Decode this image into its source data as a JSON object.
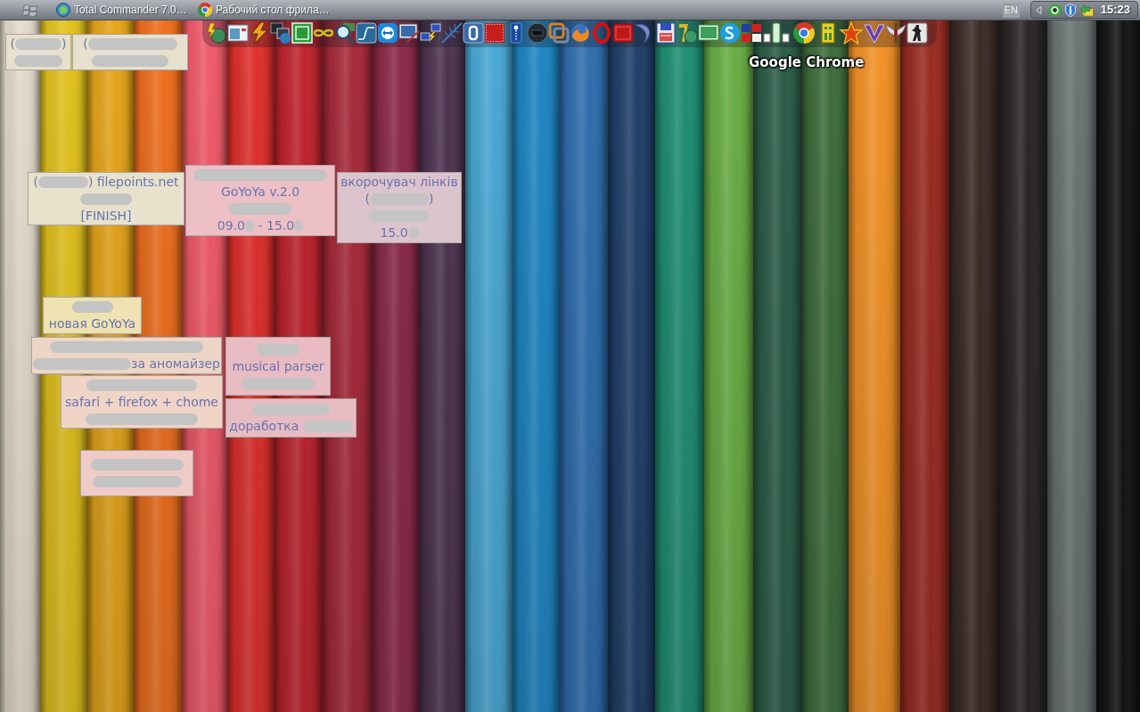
{
  "taskbar": {
    "tasks": [
      {
        "label": "Total Commander 7.0…"
      },
      {
        "label": "Рабочий стол фрила…"
      }
    ],
    "language": "EN",
    "clock": "15:23"
  },
  "dock": {
    "tooltip": "Google Chrome"
  },
  "notes": [
    {
      "color": "#e6e0cc",
      "lines": [
        [
          {
            "kind": "text",
            "text": "("
          },
          {
            "kind": "redacted"
          },
          {
            "kind": "text",
            "text": ")"
          }
        ],
        [
          {
            "kind": "redacted"
          }
        ]
      ]
    },
    {
      "color": "#e6e0cc",
      "lines": [
        [
          {
            "kind": "text",
            "text": "("
          },
          {
            "kind": "redacted"
          }
        ],
        [
          {
            "kind": "redacted"
          }
        ]
      ]
    },
    {
      "color": "#e8e2cc",
      "lines": [
        [
          {
            "kind": "text",
            "text": "("
          },
          {
            "kind": "redacted"
          },
          {
            "kind": "text",
            "text": ") filepoints.net"
          }
        ],
        [
          {
            "kind": "redacted"
          }
        ],
        [
          {
            "kind": "text",
            "text": "[FINISH]"
          }
        ]
      ]
    },
    {
      "color": "#edc0c6",
      "lines": [
        [
          {
            "kind": "redacted"
          }
        ],
        [
          {
            "kind": "text",
            "text": "GoYoYa v.2.0"
          }
        ],
        [
          {
            "kind": "redacted"
          }
        ],
        [
          {
            "kind": "text",
            "text": "09.0"
          },
          {
            "kind": "redacted"
          },
          {
            "kind": "text",
            "text": " - 15.0"
          },
          {
            "kind": "redacted"
          }
        ]
      ]
    },
    {
      "color": "#dcc4cc",
      "lines": [
        [
          {
            "kind": "text",
            "text": "вкорочувач лінків"
          }
        ],
        [
          {
            "kind": "text",
            "text": "("
          },
          {
            "kind": "redacted"
          },
          {
            "kind": "text",
            "text": ")"
          }
        ],
        [
          {
            "kind": "redacted"
          }
        ],
        [
          {
            "kind": "text",
            "text": "15.0"
          },
          {
            "kind": "redacted"
          }
        ]
      ]
    },
    {
      "color": "#eee2b0",
      "lines": [
        [
          {
            "kind": "redacted"
          }
        ],
        [
          {
            "kind": "text",
            "text": "новая GoYoYa"
          }
        ]
      ]
    },
    {
      "color": "#eed6c6",
      "lines": [
        [
          {
            "kind": "redacted"
          }
        ],
        [
          {
            "kind": "redacted"
          },
          {
            "kind": "text",
            "text": "за аномайзер"
          }
        ]
      ]
    },
    {
      "color": "#e8bcc2",
      "lines": [
        [
          {
            "kind": "redacted"
          }
        ],
        [
          {
            "kind": "text",
            "text": "musical parser"
          }
        ],
        [
          {
            "kind": "redacted"
          }
        ]
      ]
    },
    {
      "color": "#f0d4c6",
      "lines": [
        [
          {
            "kind": "redacted"
          }
        ],
        [
          {
            "kind": "text",
            "text": "safari + firefox + chome"
          }
        ],
        [
          {
            "kind": "redacted"
          }
        ]
      ]
    },
    {
      "color": "#e6bcc2",
      "lines": [
        [
          {
            "kind": "redacted"
          }
        ],
        [
          {
            "kind": "text",
            "text": "доработка "
          },
          {
            "kind": "redacted"
          }
        ]
      ]
    },
    {
      "color": "#f0ccc8",
      "lines": [
        [
          {
            "kind": "redacted"
          }
        ],
        [
          {
            "kind": "redacted"
          }
        ]
      ]
    }
  ]
}
